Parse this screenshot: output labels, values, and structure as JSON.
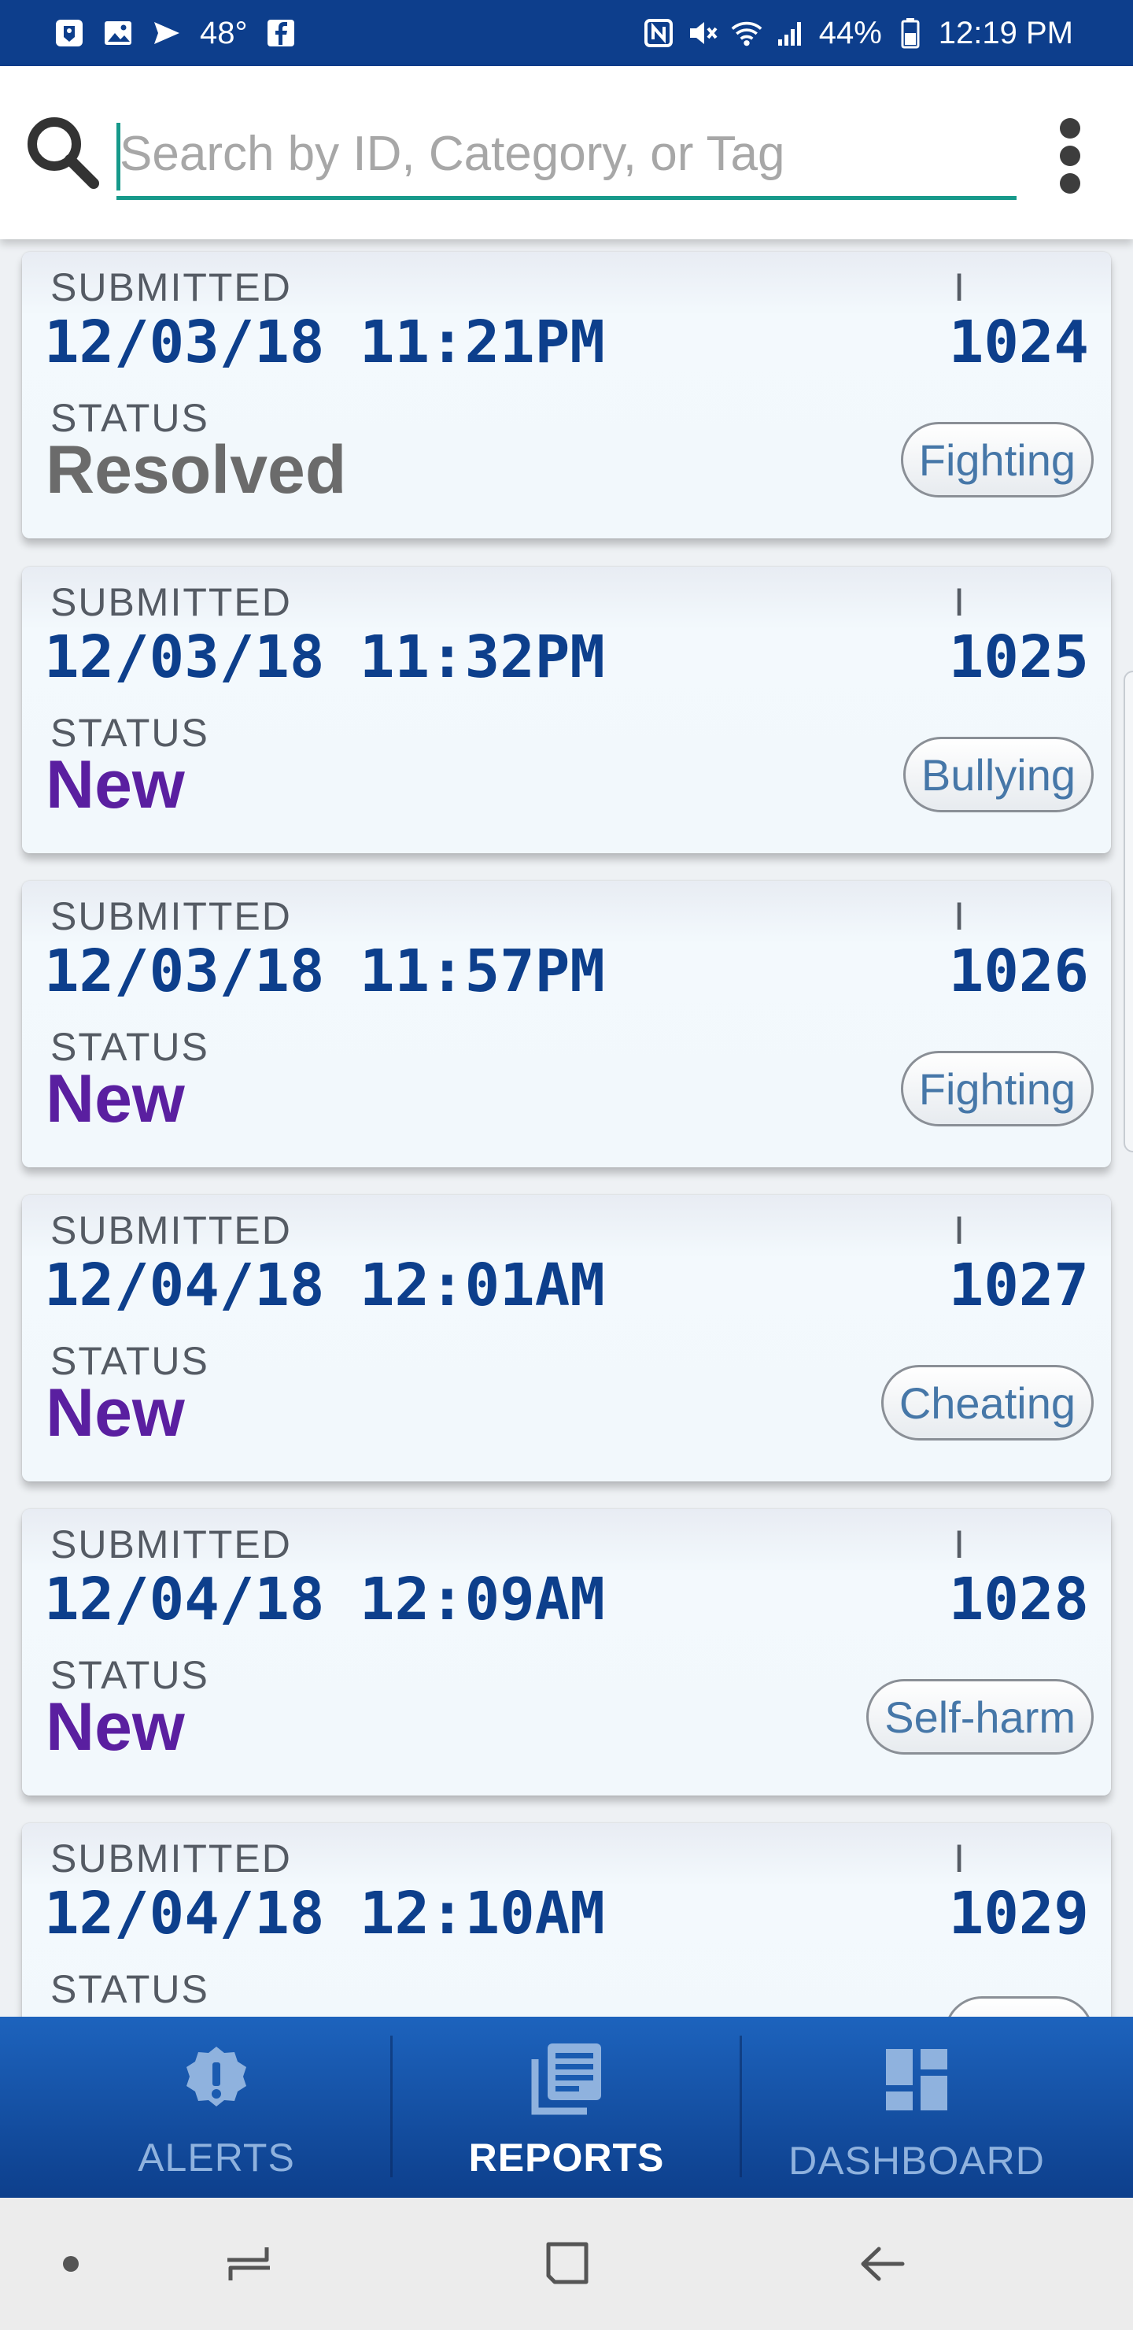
{
  "status_bar": {
    "temperature": "48°",
    "battery": "44%",
    "time": "12:19 PM",
    "icons": [
      "notification-icon",
      "gallery-icon",
      "messages-icon",
      "facebook-icon",
      "nfc-icon",
      "mute-icon",
      "wifi-icon",
      "signal-icon",
      "battery-icon"
    ]
  },
  "search": {
    "placeholder": "Search by ID, Category, or Tag",
    "value": "",
    "icon": "search-icon",
    "menu_icon": "overflow-menu-icon",
    "accent_color": "#16998a"
  },
  "reports": {
    "submitted_label": "SUBMITTED",
    "status_label": "STATUS",
    "id_label": "I",
    "items": [
      {
        "datetime": "12/03/18 11:21PM",
        "id": "1024",
        "status": "Resolved",
        "status_color": "#6b6b6b",
        "tag": "Fighting"
      },
      {
        "datetime": "12/03/18 11:32PM",
        "id": "1025",
        "status": "New",
        "status_color": "#5a1fa0",
        "tag": "Bullying"
      },
      {
        "datetime": "12/03/18 11:57PM",
        "id": "1026",
        "status": "New",
        "status_color": "#5a1fa0",
        "tag": "Fighting"
      },
      {
        "datetime": "12/04/18 12:01AM",
        "id": "1027",
        "status": "New",
        "status_color": "#5a1fa0",
        "tag": "Cheating"
      },
      {
        "datetime": "12/04/18 12:09AM",
        "id": "1028",
        "status": "New",
        "status_color": "#5a1fa0",
        "tag": "Self-harm"
      },
      {
        "datetime": "12/04/18 12:10AM",
        "id": "1029",
        "status": "",
        "status_color": "#5a1fa0",
        "tag": ""
      }
    ]
  },
  "bottom_nav": {
    "items": [
      {
        "label": "ALERTS",
        "icon": "alert-badge-icon",
        "active": false
      },
      {
        "label": "REPORTS",
        "icon": "reports-icon",
        "active": true
      },
      {
        "label": "DASHBOARD",
        "icon": "dashboard-icon",
        "active": false
      }
    ],
    "active_color": "#ffffff",
    "inactive_color": "#8fb2de"
  },
  "system_nav": {
    "items": [
      "dot-icon",
      "recents-icon",
      "home-icon",
      "back-icon"
    ]
  }
}
